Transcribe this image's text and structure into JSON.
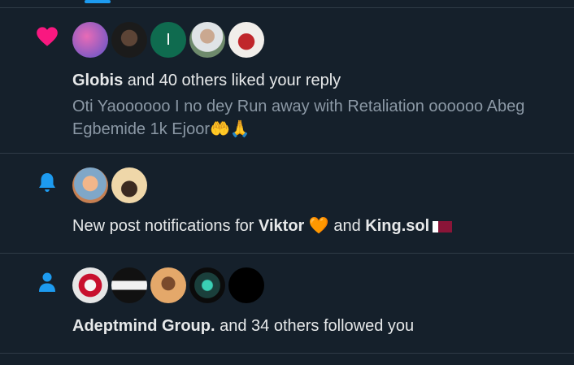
{
  "notifications": [
    {
      "type": "like",
      "icon": "heart-icon",
      "icon_color": "#f91880",
      "actor": "Globis",
      "text_after": " and 40 others liked your reply",
      "reply_text": "Oti Yaoooooo I no dey Run away with Retaliation oooooo Abeg Egbemide 1k Ejoor",
      "reply_emojis": "🤲🙏",
      "avatars": [
        {
          "label": "",
          "color": "#6a4fb3"
        },
        {
          "label": "",
          "color": "#1b1b1b"
        },
        {
          "label": "I",
          "color": "#0f6b4f"
        },
        {
          "label": "",
          "color": "#7a8a77"
        },
        {
          "label": "",
          "color": "#e8e2df"
        }
      ]
    },
    {
      "type": "post_notifications",
      "icon": "bell-icon",
      "icon_color": "#1d9bf0",
      "prefix": "New post notifications for ",
      "name1": "Viktor",
      "name1_emoji": "🧡",
      "middle": " and ",
      "name2": "King.sol",
      "avatars": [
        {
          "label": "",
          "color": "#c67f51"
        },
        {
          "label": "",
          "color": "#efd7a9"
        }
      ]
    },
    {
      "type": "follow",
      "icon": "person-icon",
      "icon_color": "#1d9bf0",
      "actor": "Adeptmind Group.",
      "text_after": " and 34 others followed you",
      "avatars": [
        {
          "label": "",
          "color": "#c8102e"
        },
        {
          "label": "",
          "color": "#111111"
        },
        {
          "label": "",
          "color": "#e4a86a"
        },
        {
          "label": "",
          "color": "#1a3f3b"
        },
        {
          "label": "",
          "color": "#000000"
        }
      ]
    }
  ]
}
